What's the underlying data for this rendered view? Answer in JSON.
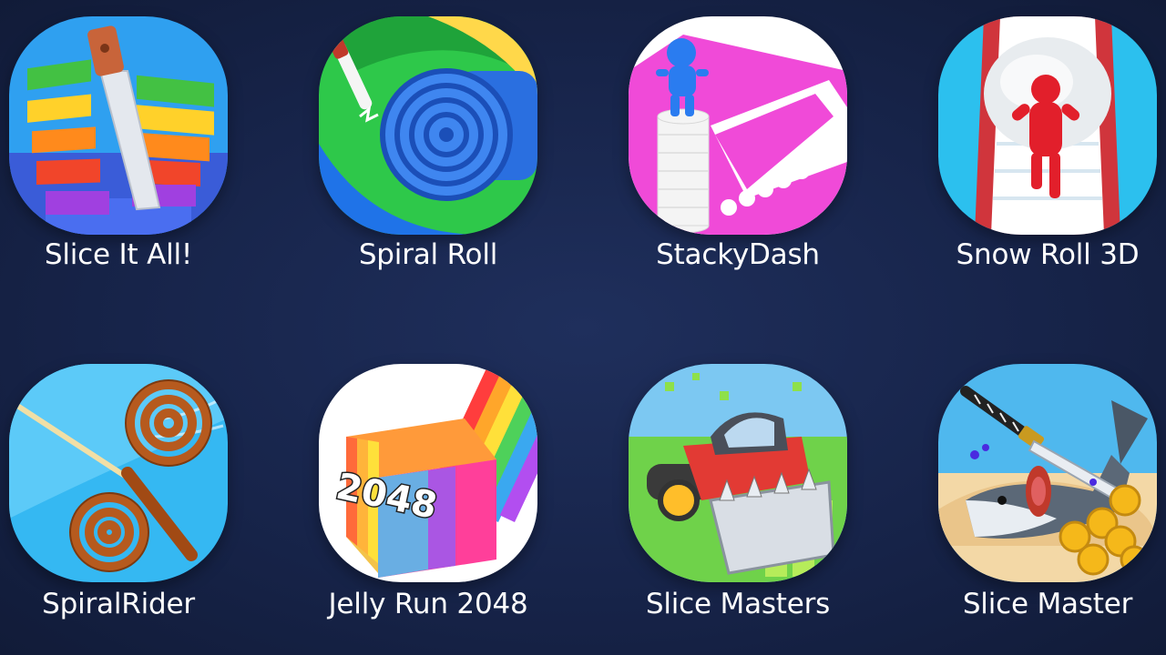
{
  "apps": [
    {
      "label": "Slice It All!",
      "icon": "slice-it-all-icon"
    },
    {
      "label": "Spiral Roll",
      "icon": "spiral-roll-icon"
    },
    {
      "label": "StackyDash",
      "icon": "stacky-dash-icon"
    },
    {
      "label": "Snow Roll 3D",
      "icon": "snow-roll-3d-icon"
    },
    {
      "label": "SpiralRider",
      "icon": "spiral-rider-icon"
    },
    {
      "label": "Jelly Run 2048",
      "icon": "jelly-run-2048-icon",
      "icon_text": "2048"
    },
    {
      "label": "Slice Masters",
      "icon": "slice-masters-icon"
    },
    {
      "label": "Slice Master",
      "icon": "slice-master-icon"
    }
  ],
  "colors": {
    "background": "#17244a",
    "label": "#ffffff"
  }
}
